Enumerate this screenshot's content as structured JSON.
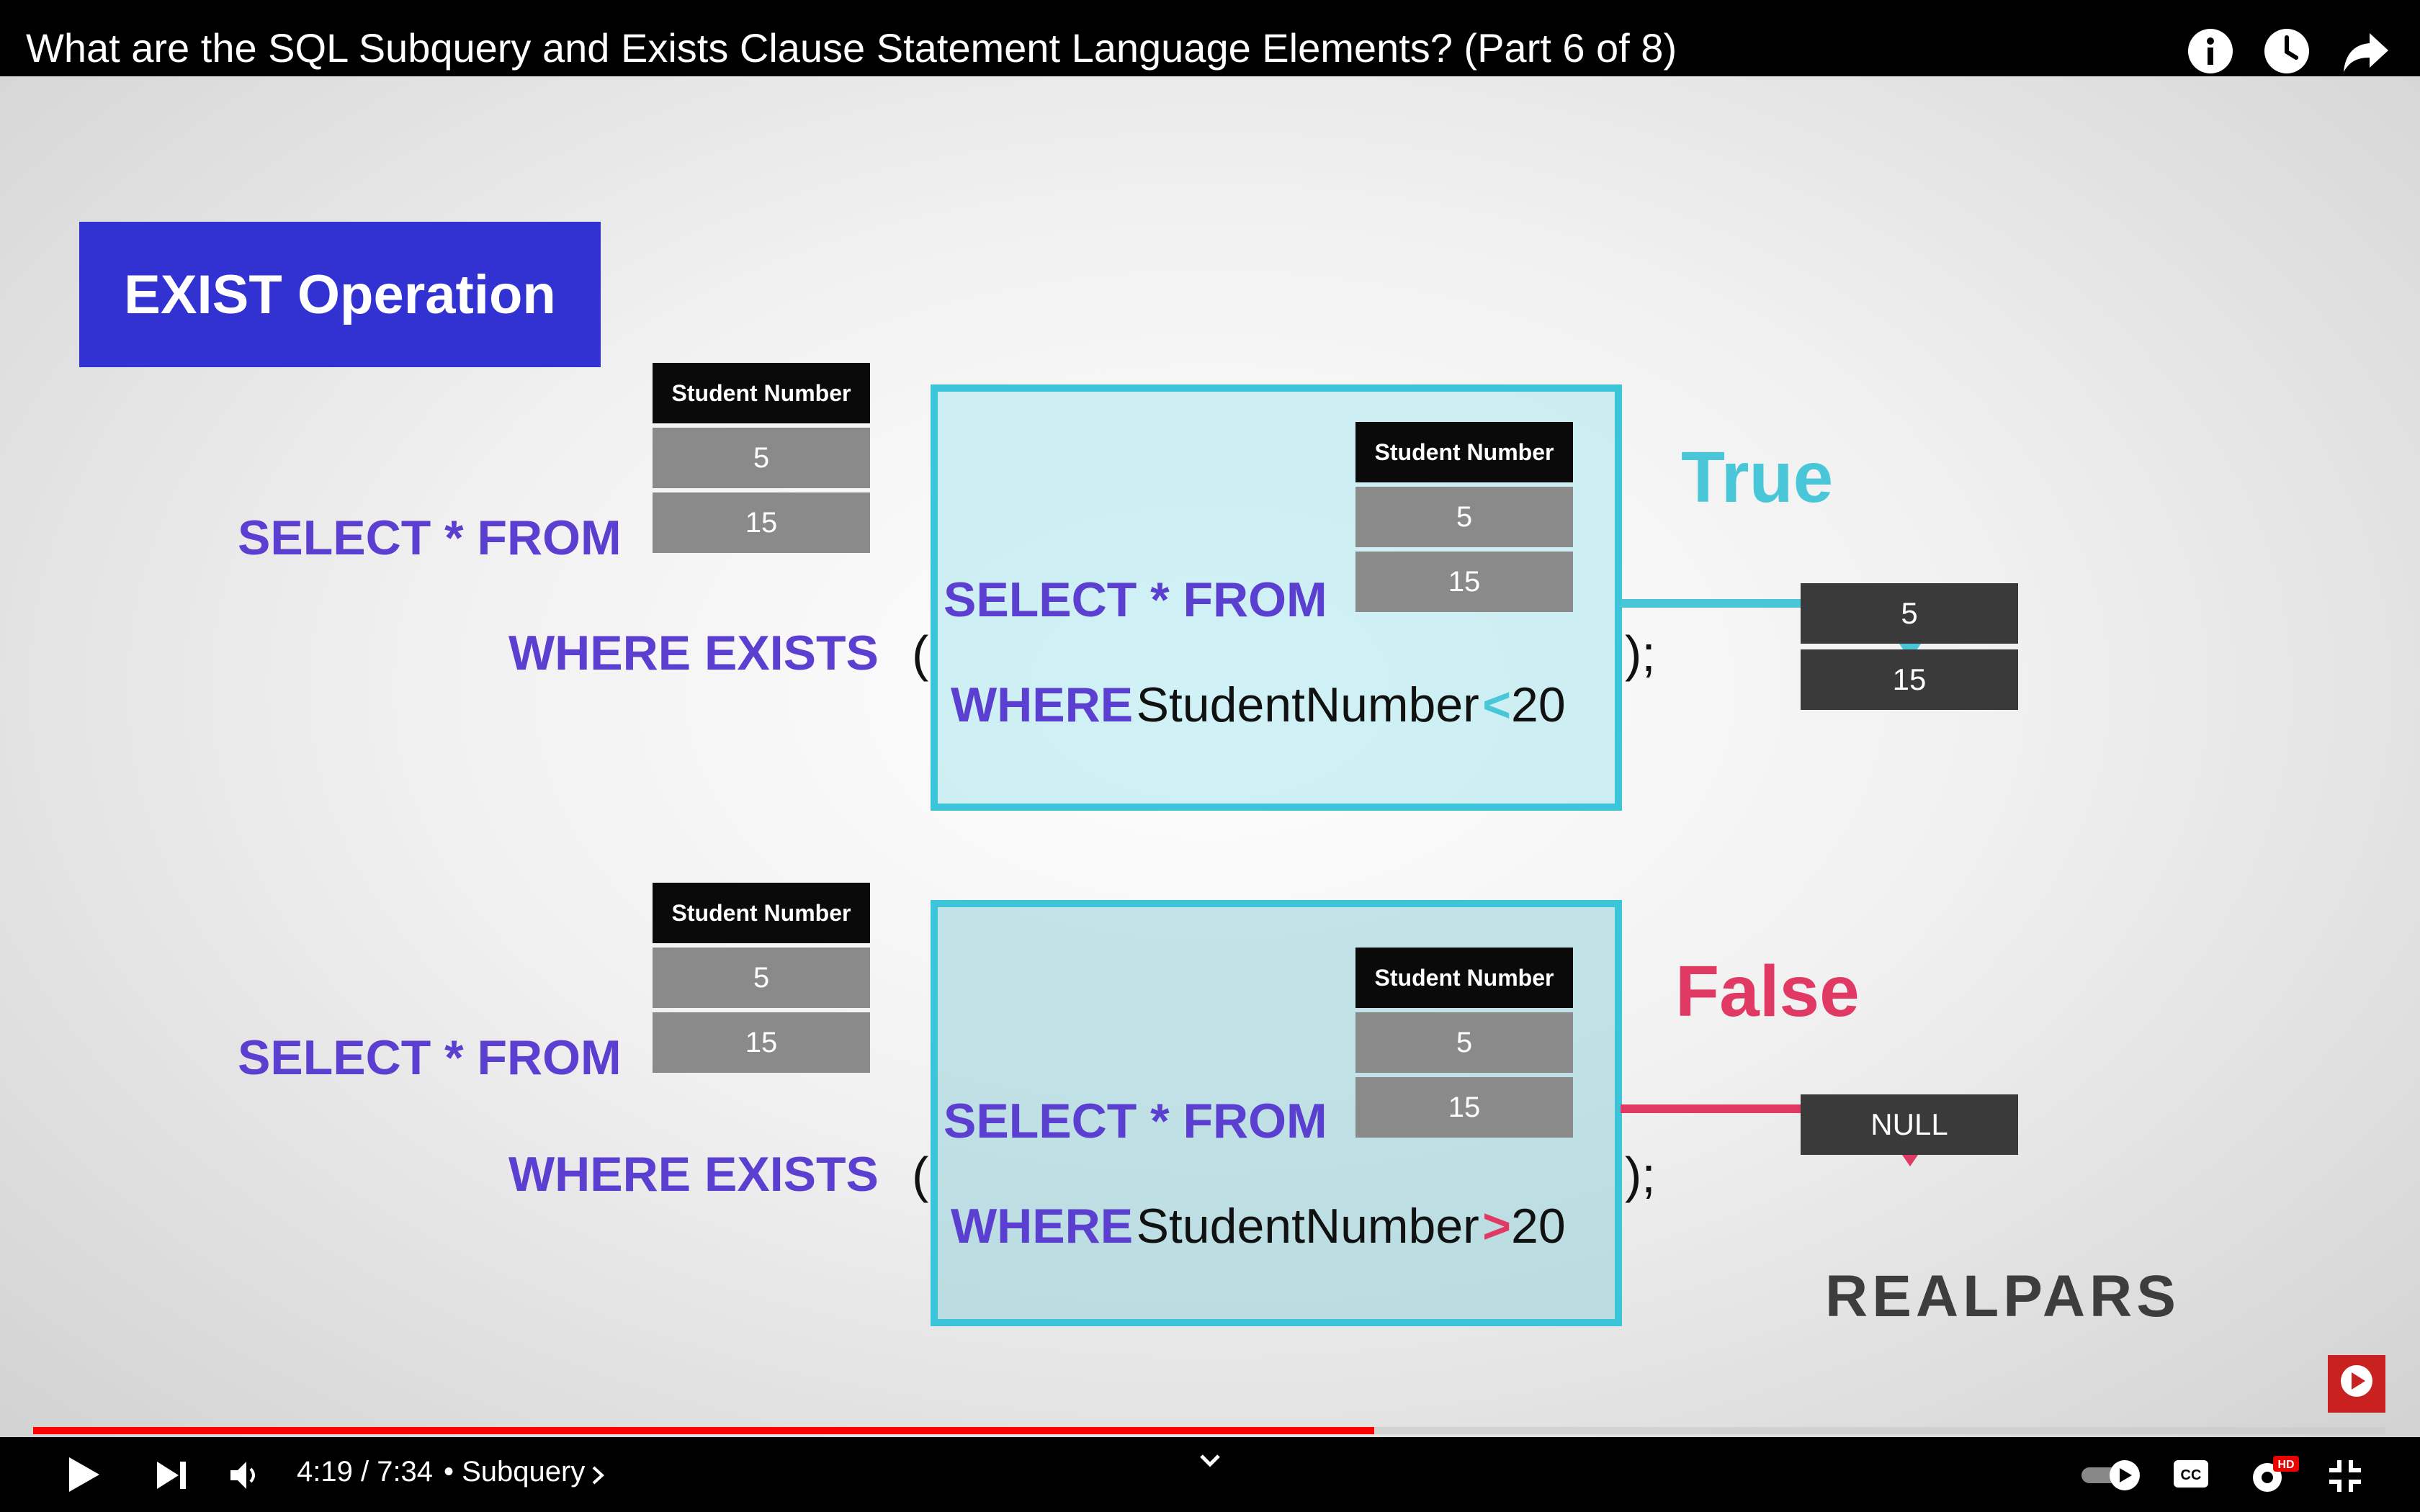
{
  "video": {
    "title": "What are the SQL Subquery and Exists Clause Statement Language Elements? (Part 6 of 8)",
    "top_icons": [
      "info-icon",
      "clock-icon",
      "share-icon"
    ]
  },
  "slide": {
    "heading": "EXIST Operation",
    "table_header": "Student Number",
    "table_values": [
      "5",
      "15"
    ],
    "select_from": "SELECT * FROM",
    "where_exists": "WHERE EXISTS",
    "open_paren": "(",
    "close_paren": ");",
    "where_kw": "WHERE",
    "column": "StudentNumber",
    "limit": "20",
    "true_case": {
      "operator": "<",
      "result_label": "True",
      "result_rows": [
        "5",
        "15"
      ],
      "color": "#49c6d8"
    },
    "false_case": {
      "operator": ">",
      "result_label": "False",
      "result_value": "NULL",
      "color": "#e03a64"
    },
    "brand": "REALPARS"
  },
  "player": {
    "time": "4:19 / 7:34",
    "chapter": "• Subquery",
    "progress": 0.57,
    "accent": "#ff0000",
    "icons": [
      "play-icon",
      "next-icon",
      "volume-icon",
      "chevron-right-icon",
      "chevron-down-icon",
      "autoplay-toggle",
      "cc-icon",
      "settings-icon",
      "exit-fullscreen-icon",
      "subscribe-icon"
    ],
    "hd_badge": "HD",
    "cc_label": "CC"
  }
}
